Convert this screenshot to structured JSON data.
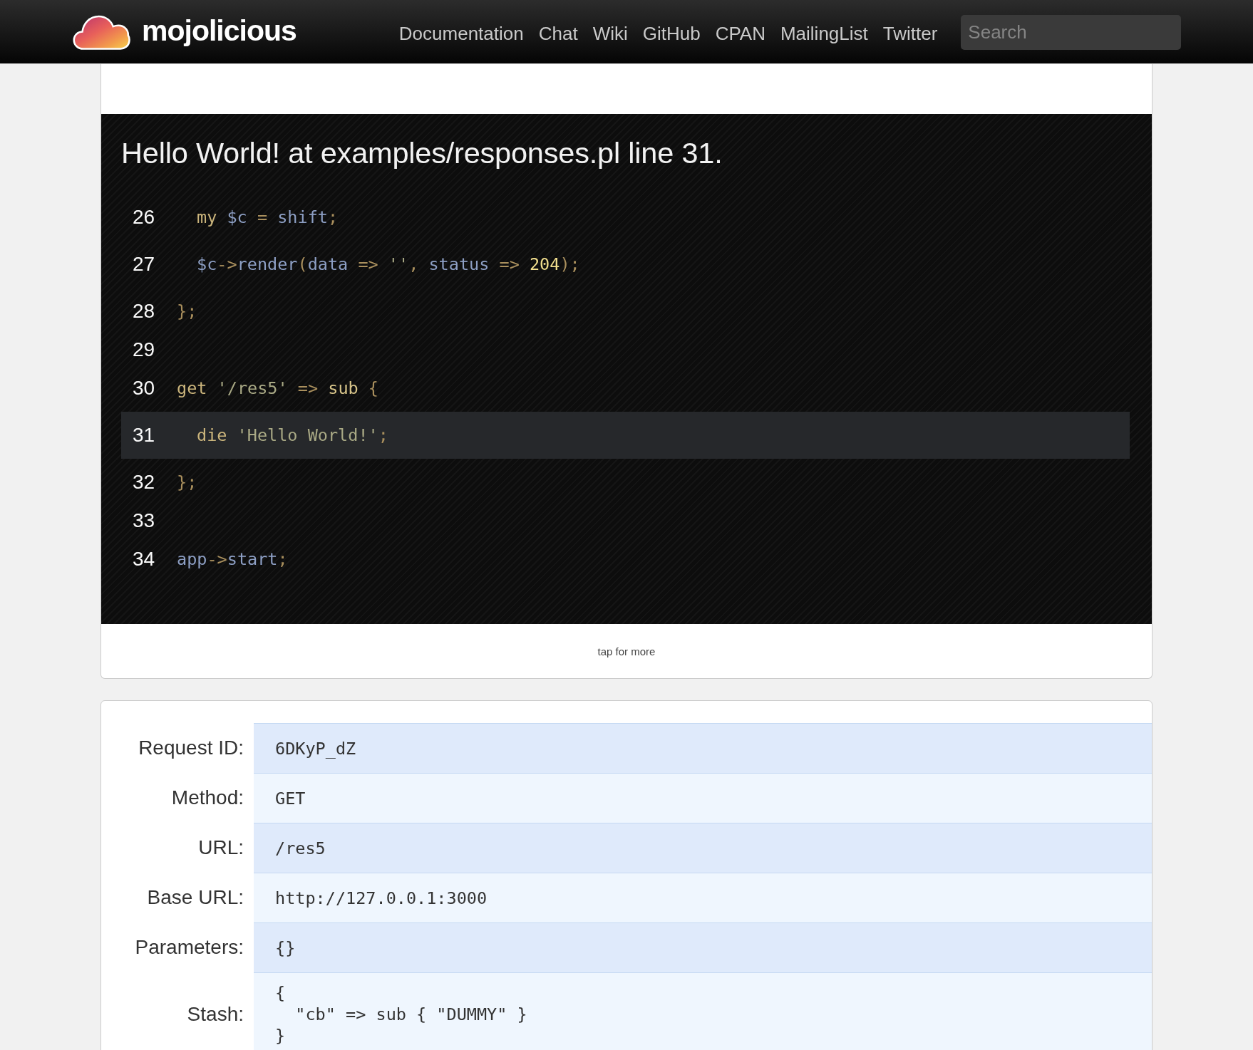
{
  "header": {
    "logo_text": "mojolicious",
    "nav": [
      "Documentation",
      "Chat",
      "Wiki",
      "GitHub",
      "CPAN",
      "MailingList",
      "Twitter"
    ],
    "search": {
      "placeholder": "Search"
    }
  },
  "error": {
    "title": "Hello World! at examples/responses.pl line 31.",
    "lines": [
      {
        "number": "26",
        "indented": true,
        "highlighted": false,
        "tokens": [
          {
            "text": "my",
            "color": "#cbb57c"
          },
          {
            "text": " $c",
            "color": "#8d9fc4"
          },
          {
            "text": " =",
            "color": "#a98f5d"
          },
          {
            "text": " shift",
            "color": "#8d9fc4"
          },
          {
            "text": ";",
            "color": "#a98f5d"
          }
        ]
      },
      {
        "number": "27",
        "indented": true,
        "highlighted": false,
        "tokens": [
          {
            "text": "$c",
            "color": "#8d9fc4"
          },
          {
            "text": "->",
            "color": "#a98f5d"
          },
          {
            "text": "render",
            "color": "#8d9fc4"
          },
          {
            "text": "(",
            "color": "#a98f5d"
          },
          {
            "text": "data",
            "color": "#8d9fc4"
          },
          {
            "text": " =>",
            "color": "#a98f5d"
          },
          {
            "text": " ''",
            "color": "#a9a985"
          },
          {
            "text": ",",
            "color": "#a98f5d"
          },
          {
            "text": " status",
            "color": "#8d9fc4"
          },
          {
            "text": " =>",
            "color": "#a98f5d"
          },
          {
            "text": " 204",
            "color": "#f2df8e"
          },
          {
            "text": ")",
            "color": "#a98f5d"
          },
          {
            "text": ";",
            "color": "#a98f5d"
          }
        ]
      },
      {
        "number": "28",
        "indented": false,
        "highlighted": false,
        "tokens": [
          {
            "text": "};",
            "color": "#a98f5d"
          }
        ]
      },
      {
        "number": "29",
        "highlighted": false
      },
      {
        "number": "30",
        "indented": false,
        "highlighted": false,
        "tokens": [
          {
            "text": "get",
            "color": "#cbb57c"
          },
          {
            "text": " '/res5'",
            "color": "#a9a985"
          },
          {
            "text": " =>",
            "color": "#a98f5d"
          },
          {
            "text": " sub",
            "color": "#d8c58a"
          },
          {
            "text": " {",
            "color": "#a98f5d"
          }
        ]
      },
      {
        "number": "31",
        "indented": true,
        "highlighted": true,
        "tokens": [
          {
            "text": "die",
            "color": "#cbb57c"
          },
          {
            "text": " 'Hello World!'",
            "color": "#a9a985"
          },
          {
            "text": ";",
            "color": "#a98f5d"
          }
        ]
      },
      {
        "number": "32",
        "indented": false,
        "highlighted": false,
        "tokens": [
          {
            "text": "};",
            "color": "#a98f5d"
          }
        ]
      },
      {
        "number": "33",
        "highlighted": false
      },
      {
        "number": "34",
        "indented": false,
        "highlighted": false,
        "tokens": [
          {
            "text": "app",
            "color": "#8d9fc4"
          },
          {
            "text": "->",
            "color": "#a98f5d"
          },
          {
            "text": "start",
            "color": "#8d9fc4"
          },
          {
            "text": ";",
            "color": "#a98f5d"
          }
        ]
      }
    ],
    "more_label": "tap for more"
  },
  "request_info": {
    "rows": [
      {
        "label": "Request ID:",
        "value": "6DKyP_dZ"
      },
      {
        "label": "Method:",
        "value": "GET"
      },
      {
        "label": "URL:",
        "value": "/res5"
      },
      {
        "label": "Base URL:",
        "value": "http://127.0.0.1:3000"
      },
      {
        "label": "Parameters:",
        "value": "{}"
      },
      {
        "label": "Stash:",
        "value": "{\n  \"cb\" => sub { \"DUMMY\" }\n}"
      }
    ]
  }
}
